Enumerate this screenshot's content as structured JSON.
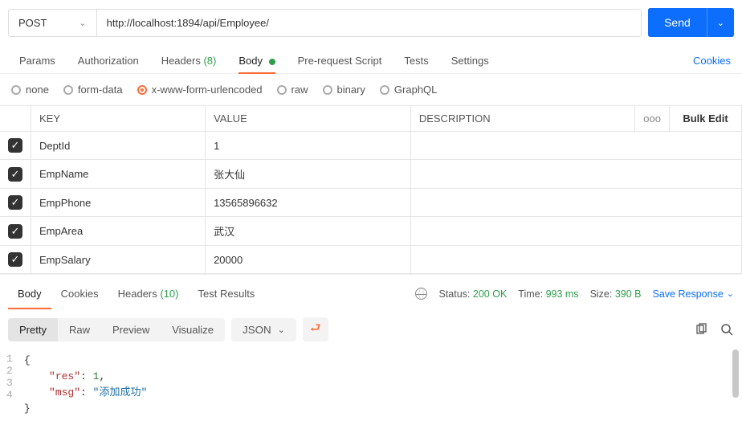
{
  "request": {
    "method": "POST",
    "url": "http://localhost:1894/api/Employee/",
    "send_label": "Send"
  },
  "tabs": {
    "params": "Params",
    "authorization": "Authorization",
    "headers": "Headers",
    "headers_count": "(8)",
    "body": "Body",
    "prerequest": "Pre-request Script",
    "tests": "Tests",
    "settings": "Settings",
    "cookies": "Cookies"
  },
  "body_types": {
    "none": "none",
    "form_data": "form-data",
    "urlencoded": "x-www-form-urlencoded",
    "raw": "raw",
    "binary": "binary",
    "graphql": "GraphQL"
  },
  "table": {
    "headers": {
      "key": "KEY",
      "value": "VALUE",
      "description": "DESCRIPTION",
      "bulk": "Bulk Edit",
      "more": "ooo"
    },
    "rows": [
      {
        "key": "DeptId",
        "value": "1"
      },
      {
        "key": "EmpName",
        "value": "张大仙"
      },
      {
        "key": "EmpPhone",
        "value": "13565896632"
      },
      {
        "key": "EmpArea",
        "value": "武汉"
      },
      {
        "key": "EmpSalary",
        "value": "20000"
      }
    ]
  },
  "response": {
    "tabs": {
      "body": "Body",
      "cookies": "Cookies",
      "headers": "Headers",
      "headers_count": "(10)",
      "test_results": "Test Results"
    },
    "status_label": "Status:",
    "status_value": "200 OK",
    "time_label": "Time:",
    "time_value": "993 ms",
    "size_label": "Size:",
    "size_value": "390 B",
    "save": "Save Response"
  },
  "viewer": {
    "pretty": "Pretty",
    "raw": "Raw",
    "preview": "Preview",
    "visualize": "Visualize",
    "format": "JSON"
  },
  "json_body": {
    "line1": "{",
    "line2_key": "\"res\"",
    "line2_val": "1",
    "line3_key": "\"msg\"",
    "line3_val": "\"添加成功\"",
    "line4": "}"
  }
}
